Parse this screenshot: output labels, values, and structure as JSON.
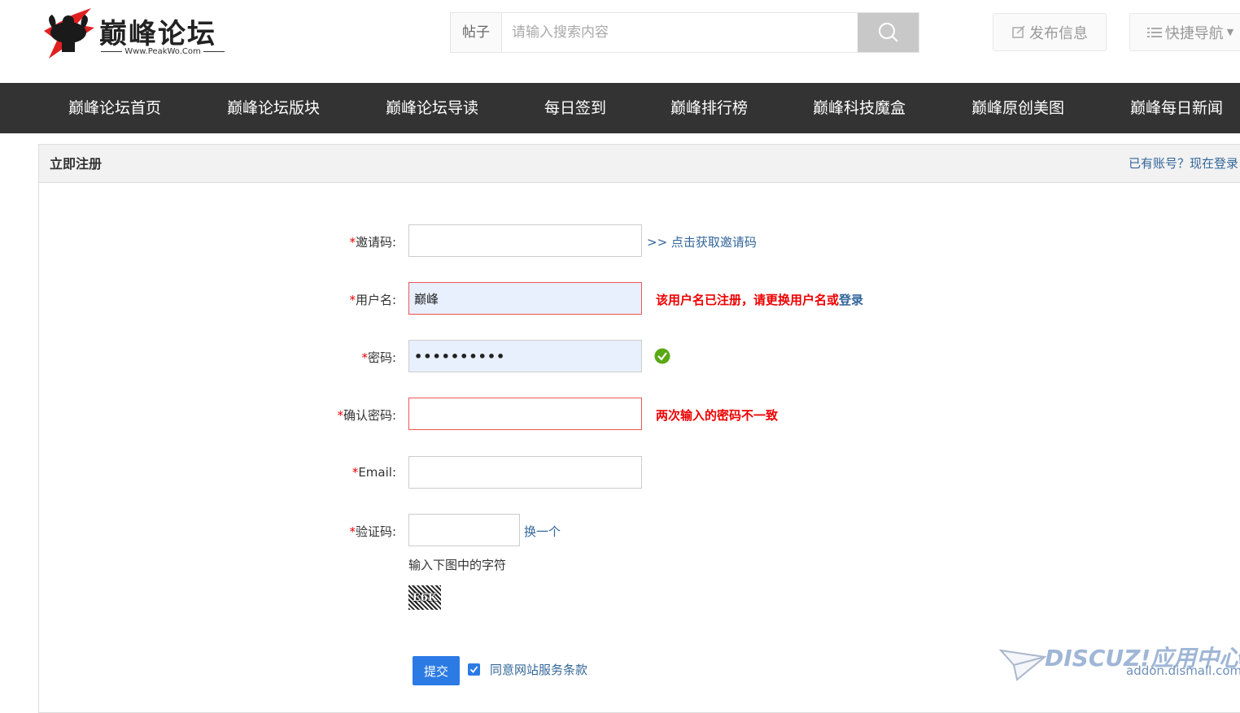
{
  "logo": {
    "brand": "巅峰论坛",
    "url": "Www.PeakWo.Com"
  },
  "search": {
    "type_label": "帖子",
    "placeholder": "请输入搜索内容",
    "value": ""
  },
  "header_buttons": {
    "publish": "发布信息",
    "quick_nav": "快捷导航"
  },
  "nav": [
    "巅峰论坛首页",
    "巅峰论坛版块",
    "巅峰论坛导读",
    "每日签到",
    "巅峰排行榜",
    "巅峰科技魔盒",
    "巅峰原创美图",
    "巅峰每日新闻"
  ],
  "panel": {
    "title": "立即注册",
    "login_link": "已有账号？现在登录"
  },
  "form": {
    "required_mark": "*",
    "invite": {
      "label": "邀请码:",
      "value": "",
      "link": ">> 点击获取邀请码"
    },
    "username": {
      "label": "用户名:",
      "value": "巅峰",
      "error": "该用户名已注册，请更换用户名或",
      "error_link": "登录"
    },
    "password": {
      "label": "密码:",
      "value": "••••••••••"
    },
    "confirm": {
      "label": "确认密码:",
      "value": "",
      "error": "两次输入的密码不一致"
    },
    "email": {
      "label": "Email:",
      "value": ""
    },
    "captcha": {
      "label": "验证码:",
      "value": "",
      "refresh": "换一个",
      "hint": "输入下图中的字符",
      "image_text": "E6K"
    }
  },
  "submit_label": "提交",
  "agree_label": "同意网站服务条款",
  "watermark": {
    "brand": "DISCUZ!应用中心",
    "sub": "addon.dismall.com"
  },
  "colors": {
    "nav_bg": "#333333",
    "accent": "#2c7be5",
    "error": "#ee0000",
    "link": "#336699"
  }
}
